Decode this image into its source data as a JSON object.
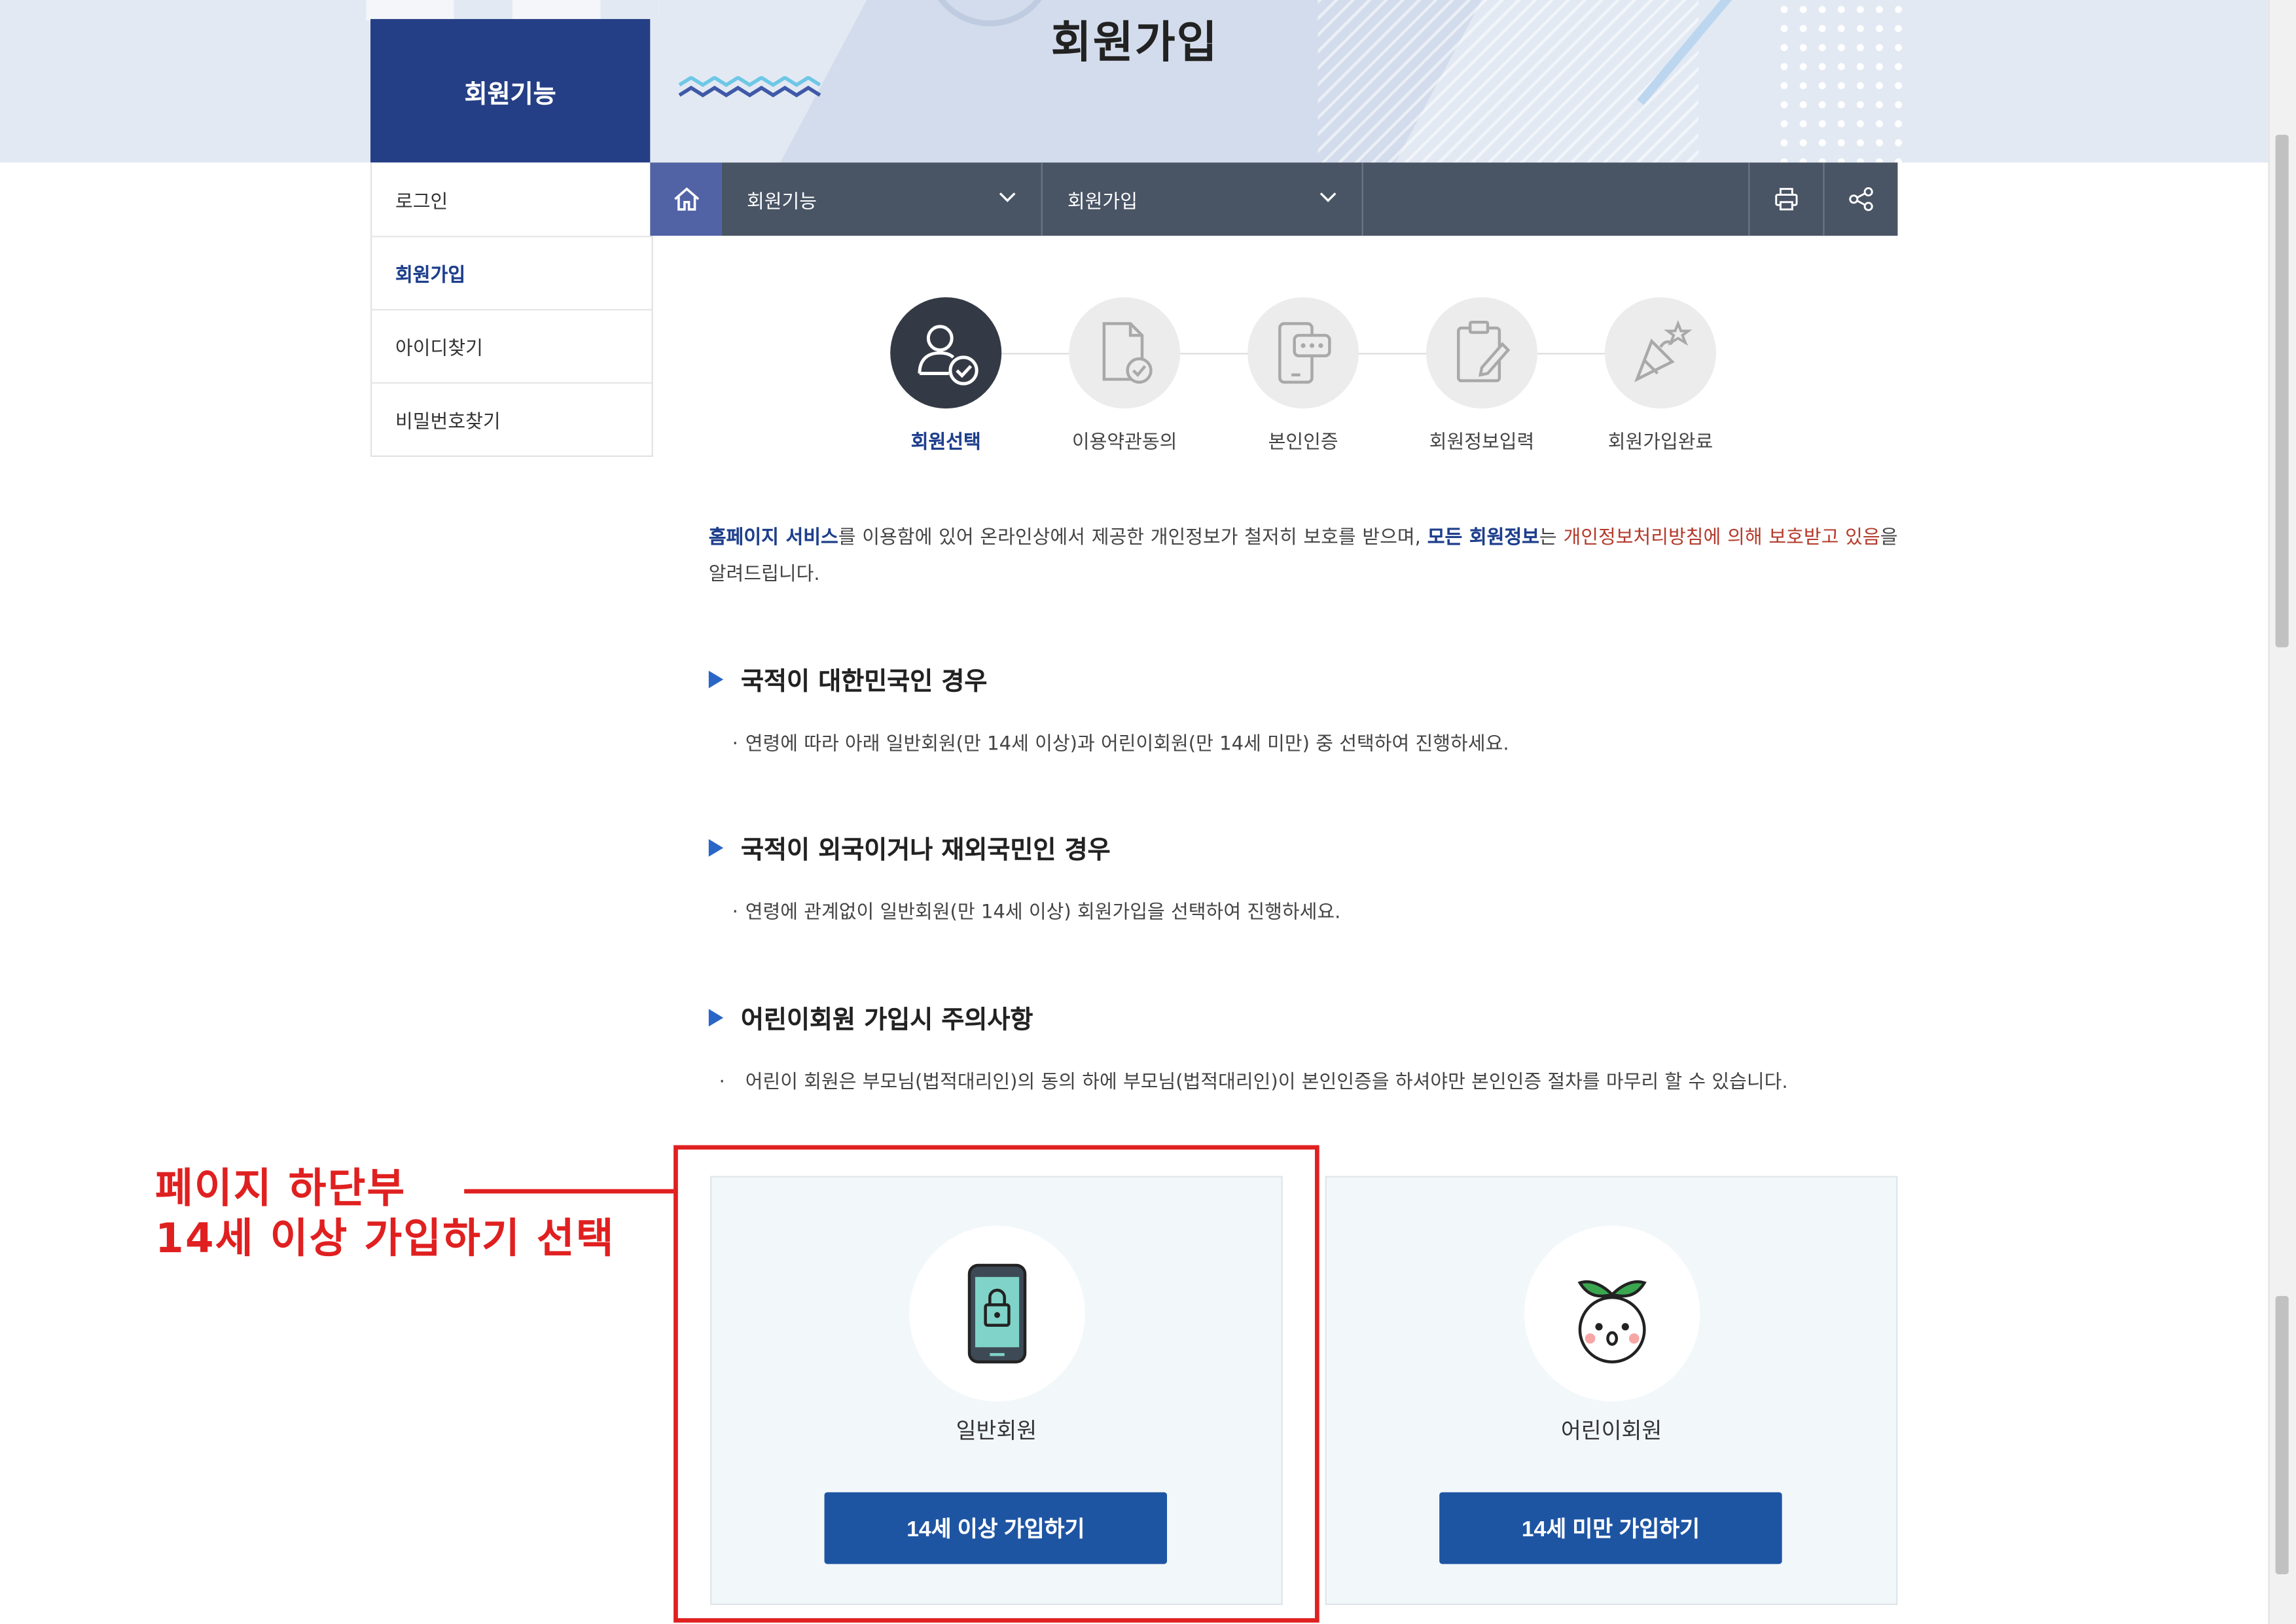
{
  "banner": {
    "title": "회원가입"
  },
  "sidebar": {
    "header": "회원기능",
    "items": [
      {
        "label": "로그인"
      },
      {
        "label": "회원가입"
      },
      {
        "label": "아이디찾기"
      },
      {
        "label": "비밀번호찾기"
      }
    ],
    "active_index": 1
  },
  "breadcrumb": {
    "home_icon": "home-icon",
    "level1": "회원기능",
    "level2": "회원가입",
    "print_icon": "print-icon",
    "share_icon": "share-icon"
  },
  "steps": [
    {
      "label": "회원선택",
      "icon": "user-check-icon",
      "active": true
    },
    {
      "label": "이용약관동의",
      "icon": "document-check-icon",
      "active": false
    },
    {
      "label": "본인인증",
      "icon": "phone-verify-icon",
      "active": false
    },
    {
      "label": "회원정보입력",
      "icon": "clipboard-edit-icon",
      "active": false
    },
    {
      "label": "회원가입완료",
      "icon": "party-popper-icon",
      "active": false
    }
  ],
  "intro": {
    "part1": "홈페이지 서비스",
    "part2": "를 이용함에 있어 온라인상에서 제공한 개인정보가 철저히 보호를 받으며, ",
    "part3": "모든 회원정보",
    "part4": "는 ",
    "part5": "개인정보처리방침에 의해 보호받고 있음",
    "part6": "을 알려드립니다."
  },
  "sections": [
    {
      "title": "국적이 대한민국인 경우",
      "body": "연령에 따라 아래 일반회원(만 14세 이상)과 어린이회원(만 14세 미만) 중 선택하여 진행하세요."
    },
    {
      "title": "국적이 외국이거나 재외국민인 경우",
      "body": "연령에 관계없이 일반회원(만 14세 이상) 회원가입을 선택하여 진행하세요."
    },
    {
      "title": "어린이회원 가입시 주의사항",
      "body": "어린이 회원은 부모님(법적대리인)의 동의 하에 부모님(법적대리인)이 본인인증을 하셔야만 본인인증 절차를 마무리 할 수 있습니다."
    }
  ],
  "bullet": "·",
  "cards": [
    {
      "label": "일반회원",
      "button": "14세 이상 가입하기",
      "icon": "locked-phone-icon"
    },
    {
      "label": "어린이회원",
      "button": "14세 미만 가입하기",
      "icon": "sprout-face-icon"
    }
  ],
  "annotation": {
    "line1": "페이지 하단부",
    "line2": "14세 이상 가입하기 선택",
    "color": "#e02020"
  },
  "colors": {
    "navy": "#253f86",
    "bar": "#495465",
    "home": "#5162a5",
    "button": "#1e55a3",
    "link_blue": "#1e3f8c",
    "link_red": "#b33a2b"
  }
}
